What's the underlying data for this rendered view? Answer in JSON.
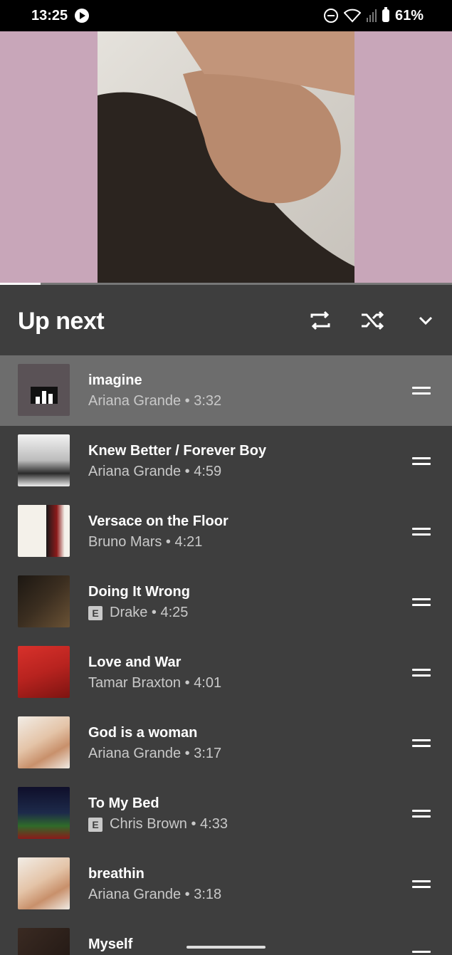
{
  "status_bar": {
    "time": "13:25",
    "battery": "61%"
  },
  "now_playing": {
    "progress_fraction": 0.09
  },
  "header": {
    "title": "Up next",
    "icons": [
      "repeat-icon",
      "shuffle-icon",
      "chevron-down-icon"
    ]
  },
  "queue": [
    {
      "title": "imagine",
      "artist": "Ariana Grande",
      "duration": "3:32",
      "explicit": false,
      "playing": true
    },
    {
      "title": "Knew Better / Forever Boy",
      "artist": "Ariana Grande",
      "duration": "4:59",
      "explicit": false
    },
    {
      "title": "Versace on the Floor",
      "artist": "Bruno Mars",
      "duration": "4:21",
      "explicit": false
    },
    {
      "title": "Doing It Wrong",
      "artist": "Drake",
      "duration": "4:25",
      "explicit": true
    },
    {
      "title": "Love and War",
      "artist": "Tamar Braxton",
      "duration": "4:01",
      "explicit": false
    },
    {
      "title": "God is a woman",
      "artist": "Ariana Grande",
      "duration": "3:17",
      "explicit": false
    },
    {
      "title": "To My Bed",
      "artist": "Chris Brown",
      "duration": "4:33",
      "explicit": true
    },
    {
      "title": "breathin",
      "artist": "Ariana Grande",
      "duration": "3:18",
      "explicit": false
    },
    {
      "title": "Myself",
      "artist": "",
      "duration": "",
      "explicit": false
    }
  ],
  "colors": {
    "background": "#3e3e3e",
    "active_row": "#6d6d6d",
    "album_pink": "#c8a6b9"
  }
}
